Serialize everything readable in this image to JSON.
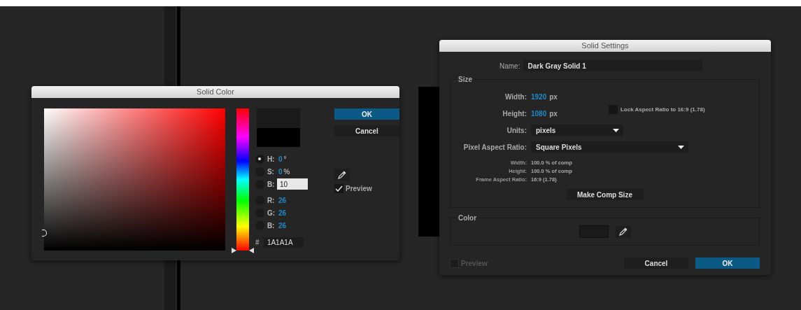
{
  "solid_color": {
    "title": "Solid Color",
    "hue": {
      "level": 0
    },
    "fields": [
      {
        "label": "H:",
        "value": "0",
        "unit": "°",
        "selected": true,
        "kind": "readout"
      },
      {
        "label": "S:",
        "value": "0",
        "unit": "%",
        "selected": false,
        "kind": "readout"
      },
      {
        "label": "B:",
        "value": "10",
        "selected": false,
        "kind": "input"
      },
      {
        "label": "R:",
        "value": "26",
        "selected": false,
        "kind": "readout"
      },
      {
        "label": "G:",
        "value": "26",
        "selected": false,
        "kind": "readout"
      },
      {
        "label": "B:",
        "value": "26",
        "selected": false,
        "kind": "readout"
      }
    ],
    "hex": {
      "label": "#",
      "value": "1A1A1A"
    },
    "ok": "OK",
    "cancel": "Cancel",
    "preview": {
      "label": "Preview",
      "checked": true
    }
  },
  "solid_settings": {
    "title": "Solid Settings",
    "name": {
      "label": "Name:",
      "value": "Dark Gray Solid 1"
    },
    "size": {
      "legend": "Size",
      "width": {
        "label": "Width:",
        "value": "1920",
        "unit": "px"
      },
      "height": {
        "label": "Height:",
        "value": "1080",
        "unit": "px"
      },
      "lock": {
        "label": "Lock Aspect Ratio to 16:9 (1.78)",
        "checked": false
      },
      "units": {
        "label": "Units:",
        "value": "pixels"
      },
      "pixel_aspect_ratio": {
        "label": "Pixel Aspect Ratio:",
        "value": "Square Pixels"
      },
      "info": [
        {
          "label": "Width:",
          "value": "100.0 % of comp"
        },
        {
          "label": "Height:",
          "value": "100.0 % of comp"
        },
        {
          "label": "Frame Aspect Ratio:",
          "value": "16:9 (1.78)"
        }
      ],
      "make_comp_size": "Make Comp Size"
    },
    "color": {
      "legend": "Color"
    },
    "preview": {
      "label": "Preview",
      "checked": false,
      "disabled": true
    },
    "cancel": "Cancel",
    "ok": "OK"
  }
}
